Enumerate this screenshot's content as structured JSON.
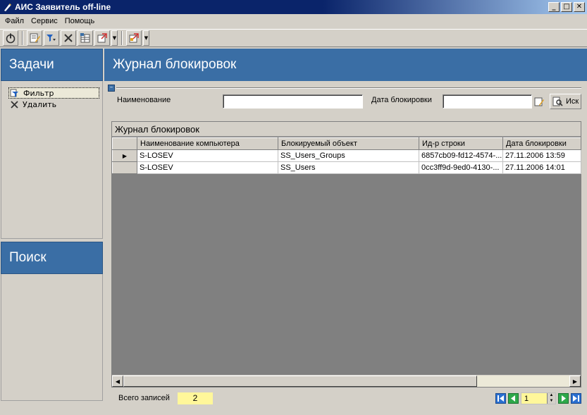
{
  "window": {
    "title": "АИС Заявитель off-line",
    "controls": {
      "minimize": "_",
      "maximize": "□",
      "close": "✕"
    }
  },
  "menu": [
    "Файл",
    "Сервис",
    "Помощь"
  ],
  "toolbar": {
    "icons": [
      "power-icon",
      "edit-icon",
      "filter-icon",
      "delete-icon",
      "table-icon",
      "export-icon",
      "report-icon"
    ]
  },
  "tasks_panel": {
    "title": "Задачи",
    "items": [
      {
        "label": "Фильтр",
        "icon": "filter-icon",
        "selected": true
      },
      {
        "label": "Удалить",
        "icon": "delete-icon",
        "selected": false
      }
    ]
  },
  "search_panel": {
    "title": "Поиск"
  },
  "main": {
    "title": "Журнал блокировок",
    "filter": {
      "name_label": "Наименование",
      "name_value": "",
      "date_label": "Дата блокировки",
      "date_value": "",
      "find_button": "Иск"
    },
    "grid": {
      "caption": "Журнал блокировок",
      "columns": [
        "Наименование компьютера",
        "Блокируемый объект",
        "Ид-р строки",
        "Дата блокировки"
      ],
      "rows": [
        {
          "computer": "S-LOSEV",
          "object": "SS_Users_Groups",
          "row_id": "6857cb09-fd12-4574-...",
          "date": "27.11.2006 13:59",
          "current": true
        },
        {
          "computer": "S-LOSEV",
          "object": "SS_Users",
          "row_id": "0cc3ff9d-9ed0-4130-...",
          "date": "27.11.2006 14:01",
          "current": false
        }
      ]
    },
    "footer": {
      "total_label": "Всего записей",
      "total_value": "2",
      "page": "1"
    }
  },
  "colors": {
    "accent": "#3a6ea5",
    "highlight": "#fff79a",
    "title_bar": "#0a246a"
  }
}
